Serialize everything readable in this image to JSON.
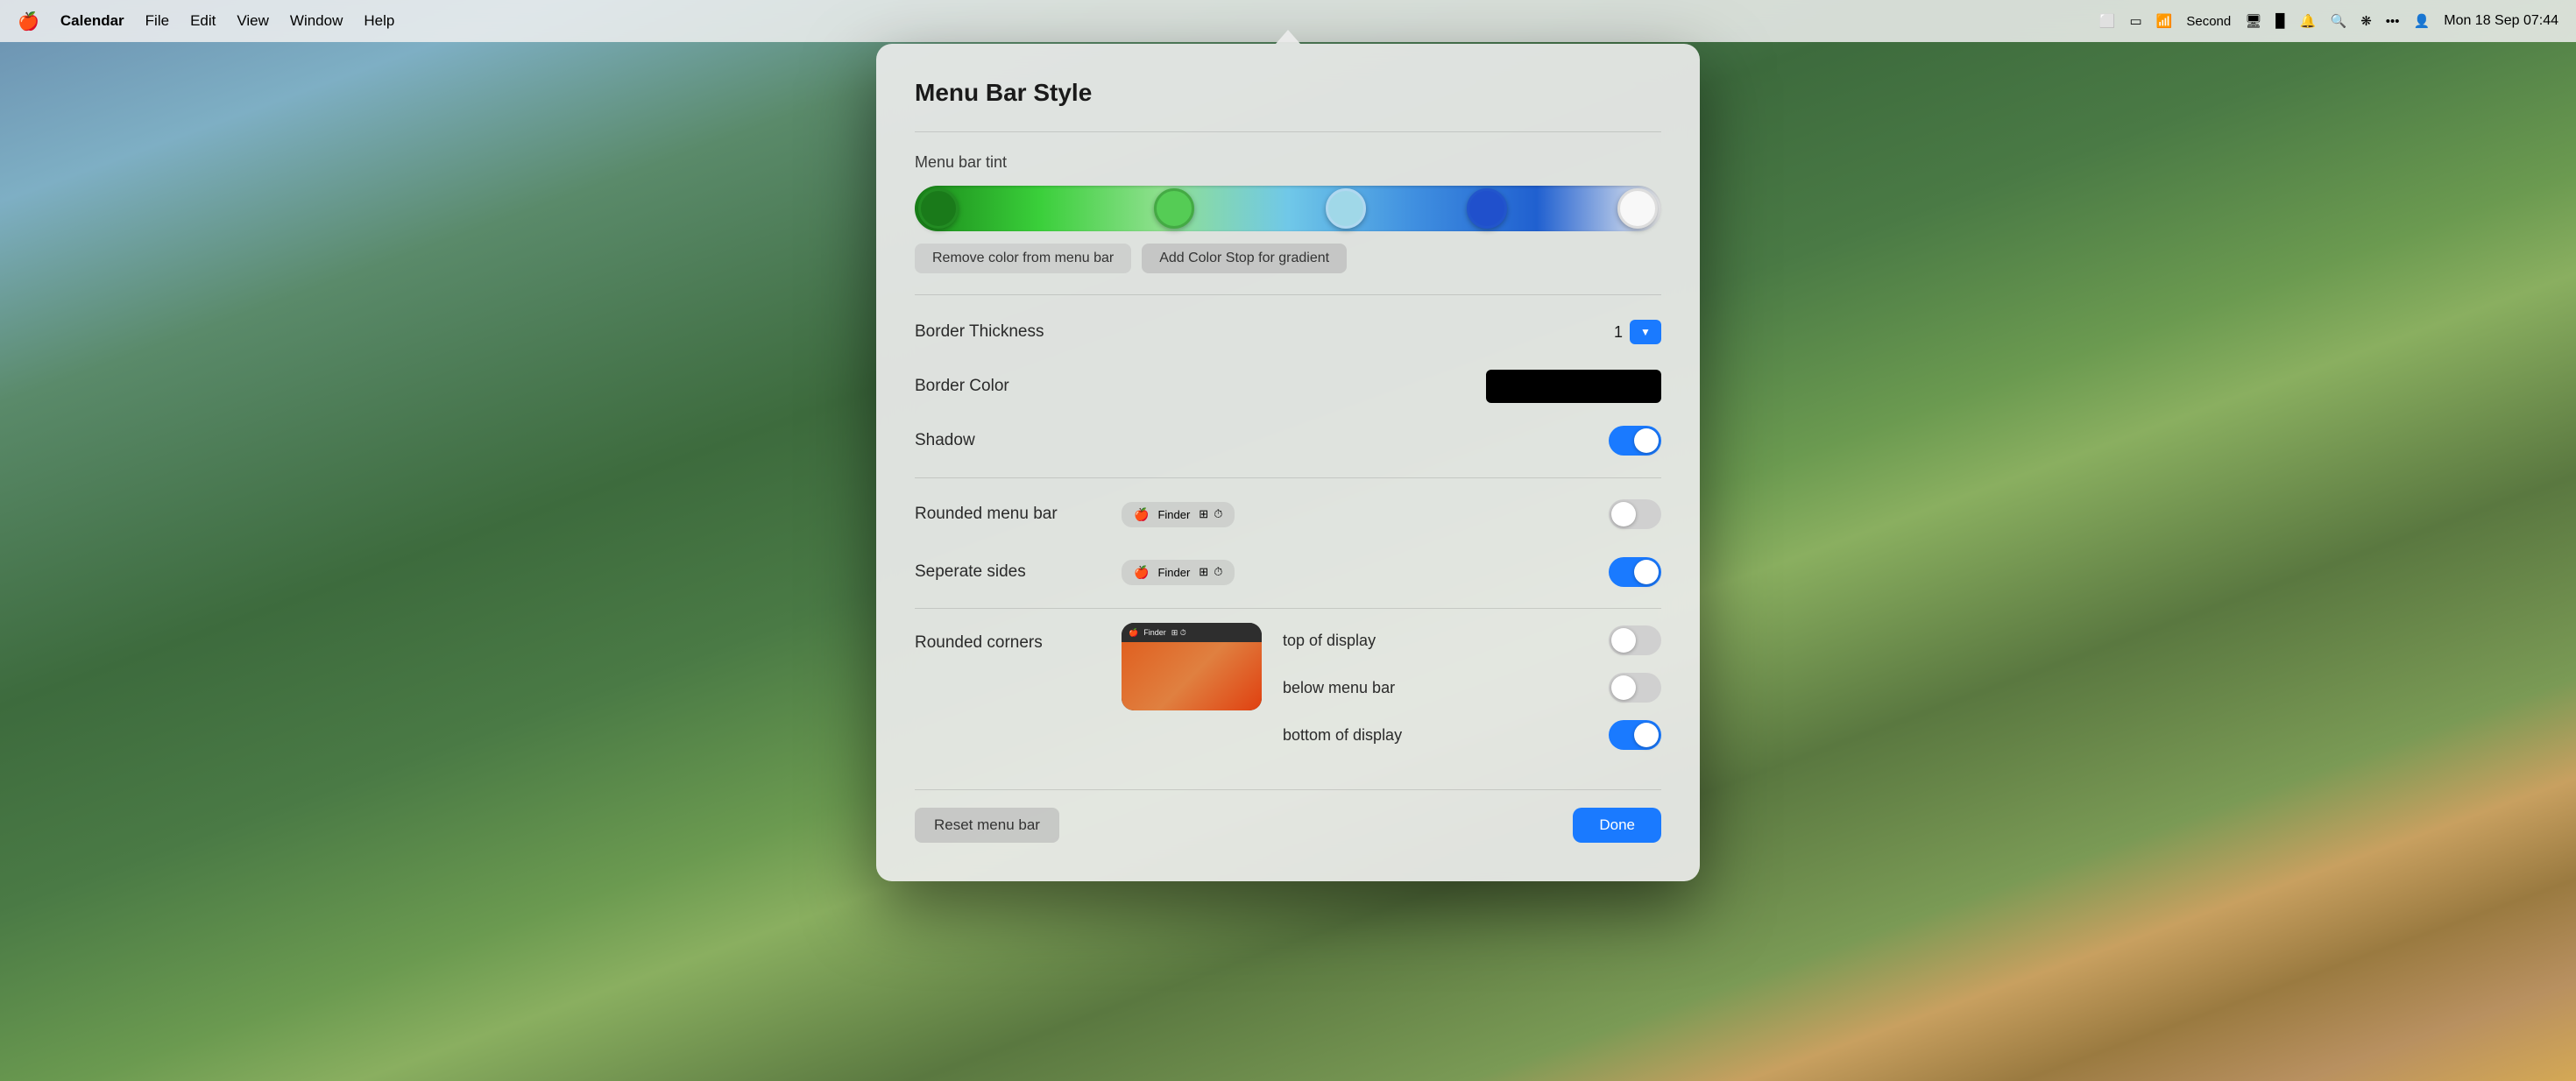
{
  "menubar": {
    "apple": "🍎",
    "app_name": "Calendar",
    "items": [
      "File",
      "Edit",
      "View",
      "Window",
      "Help"
    ],
    "right_items": [
      "⬜",
      "▭",
      "📶",
      "Second",
      "🖥",
      "▉",
      "🔔",
      "🔍",
      "❋",
      "•••",
      "👤"
    ],
    "datetime": "Mon 18 Sep  07:44"
  },
  "dialog": {
    "title": "Menu Bar Style",
    "sections": {
      "tint": {
        "label": "Menu bar tint",
        "remove_btn": "Remove color from menu bar",
        "add_btn": "Add Color Stop for gradient"
      },
      "border": {
        "thickness_label": "Border Thickness",
        "thickness_value": "1",
        "color_label": "Border Color",
        "shadow_label": "Shadow"
      },
      "rounded": {
        "menu_bar_label": "Rounded menu bar",
        "separate_sides_label": "Seperate sides",
        "preview_apple": "",
        "preview_finder": "Finder",
        "preview_icons": "⏱ 🕐"
      },
      "corners": {
        "label": "Rounded corners",
        "top_label": "top of display",
        "below_label": "below menu bar",
        "bottom_label": "bottom of display"
      }
    },
    "footer": {
      "reset_label": "Reset menu bar",
      "done_label": "Done"
    }
  },
  "toggles": {
    "shadow": "on",
    "rounded_menu_bar": "off",
    "separate_sides": "on",
    "top_of_display": "off",
    "below_menu_bar": "off",
    "bottom_of_display": "on"
  }
}
